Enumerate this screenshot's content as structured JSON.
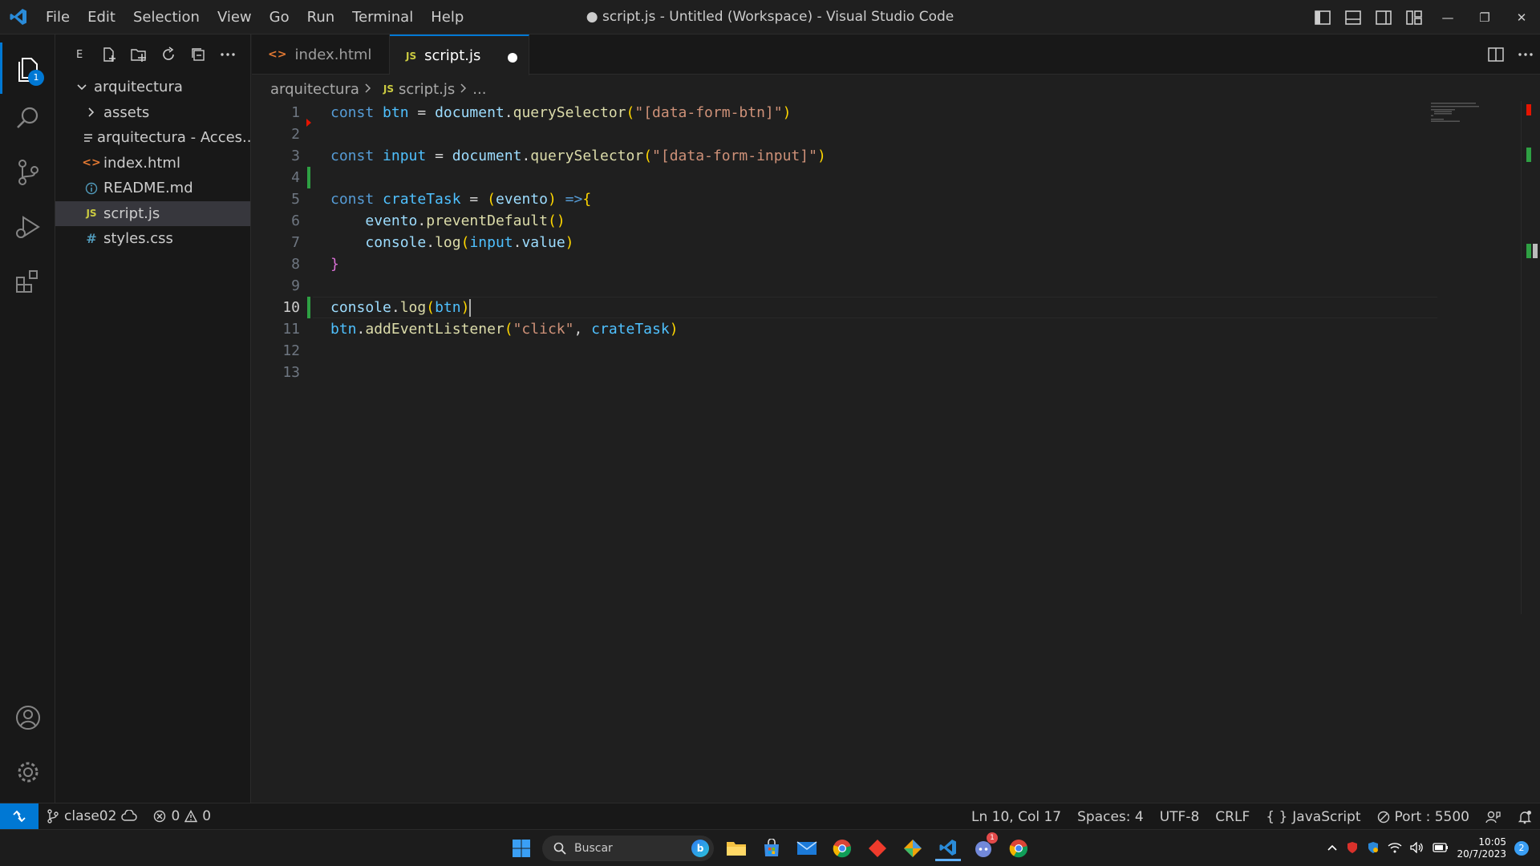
{
  "titlebar": {
    "menu": [
      "File",
      "Edit",
      "Selection",
      "View",
      "Go",
      "Run",
      "Terminal",
      "Help"
    ],
    "title": "● script.js - Untitled (Workspace) - Visual Studio Code"
  },
  "activitybar": {
    "explorer_badge": "1"
  },
  "sidebar": {
    "title": "E",
    "tree": [
      {
        "label": "arquitectura",
        "icon": "chevron-down"
      },
      {
        "label": "assets",
        "icon": "chevron-right"
      },
      {
        "label": "arquitectura - Acces...",
        "icon": "lines"
      },
      {
        "label": "index.html",
        "icon": "html"
      },
      {
        "label": "README.md",
        "icon": "info"
      },
      {
        "label": "script.js",
        "icon": "js"
      },
      {
        "label": "styles.css",
        "icon": "css"
      }
    ]
  },
  "tabs": [
    {
      "label": "index.html",
      "icon_glyph": "<>"
    },
    {
      "label": "script.js",
      "icon_glyph": "JS",
      "dirty": true
    }
  ],
  "breadcrumb": {
    "folder": "arquitectura",
    "file_icon": "JS",
    "file": "script.js",
    "more": "..."
  },
  "editor": {
    "current_line": 10,
    "line_numbers": [
      "1",
      "2",
      "3",
      "4",
      "5",
      "6",
      "7",
      "8",
      "9",
      "10",
      "11",
      "12",
      "13"
    ],
    "lines": [
      "const btn = document.querySelector(\"[data-form-btn]\")",
      "",
      "const input = document.querySelector(\"[data-form-input]\")",
      "",
      "const crateTask = (evento) =>{",
      "    evento.preventDefault()",
      "    console.log(input.value)",
      "}",
      "",
      "console.log(btn)",
      "btn.addEventListener(\"click\", crateTask)",
      "",
      ""
    ]
  },
  "statusbar": {
    "branch": "clase02",
    "errors": "0",
    "warnings": "0",
    "position": "Ln 10, Col 17",
    "spaces": "Spaces: 4",
    "encoding": "UTF-8",
    "eol": "CRLF",
    "language": "JavaScript",
    "port": "Port : 5500"
  },
  "taskbar": {
    "search_placeholder": "Buscar",
    "time": "10:05",
    "date": "20/7/2023",
    "notif_count": "2",
    "discord_badge": "1"
  },
  "colors": {
    "accent": "#0078d4",
    "editor_bg": "#1f1f1f",
    "git_added": "#2ea043"
  }
}
